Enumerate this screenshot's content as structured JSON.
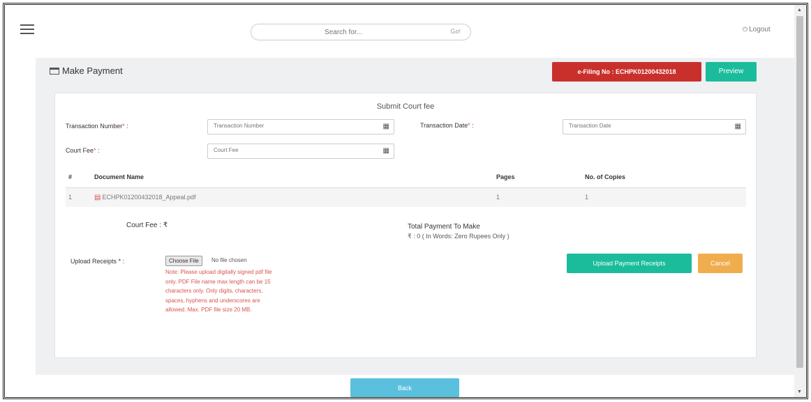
{
  "header": {
    "search_placeholder": "Search for...",
    "search_button": "Go!",
    "logout_label": "Logout"
  },
  "page": {
    "title": "Make Payment",
    "efiling_badge": "e-Filing No : ECHPK01200432018",
    "preview_button": "Preview"
  },
  "form": {
    "section_title": "Submit Court fee",
    "transaction_number_label": "Transaction Number",
    "transaction_number_placeholder": "Transaction Number",
    "transaction_date_label": "Transaction Date",
    "transaction_date_placeholder": "Transaction Date",
    "court_fee_label": "Court Fee",
    "court_fee_placeholder": "Court Fee",
    "required_marker": "*",
    "colon": ":"
  },
  "table": {
    "headers": [
      "#",
      "Document Name",
      "Pages",
      "No. of Copies"
    ],
    "rows": [
      {
        "index": "1",
        "document_name": "ECHPK01200432018_Appeal.pdf",
        "pages": "1",
        "copies": "1"
      }
    ]
  },
  "summary": {
    "court_fee_text": "Court Fee :  ₹",
    "total_payment_label": "Total Payment To Make",
    "total_payment_value": "₹ : 0  ( In Words: Zero Rupees Only )"
  },
  "upload": {
    "label": "Upload Receipts",
    "choose_file": "Choose File",
    "no_file": "No file chosen",
    "note": "Note: Please upload digitally signed pdf file only. PDF File name max length can be 15 characters only. Only digits, characters, spaces, hyphens and underscores are allowed. Max. PDF file size 20 MB.",
    "upload_button": "Upload Payment Receipts",
    "cancel_button": "Cancel"
  },
  "footer": {
    "bottom_button": "Back"
  },
  "colors": {
    "efiling_badge": "#c9302c",
    "preview_button": "#1abc9c",
    "upload_button": "#1abc9c",
    "cancel_button": "#f0ad4e",
    "bottom_button": "#5bc0de",
    "error_note": "#d9534f"
  },
  "icons": {
    "menu": "hamburger-icon",
    "logout": "power-icon",
    "page_title": "credit-card-icon",
    "calendar": "calendar-icon",
    "pdf": "pdf-file-icon"
  }
}
